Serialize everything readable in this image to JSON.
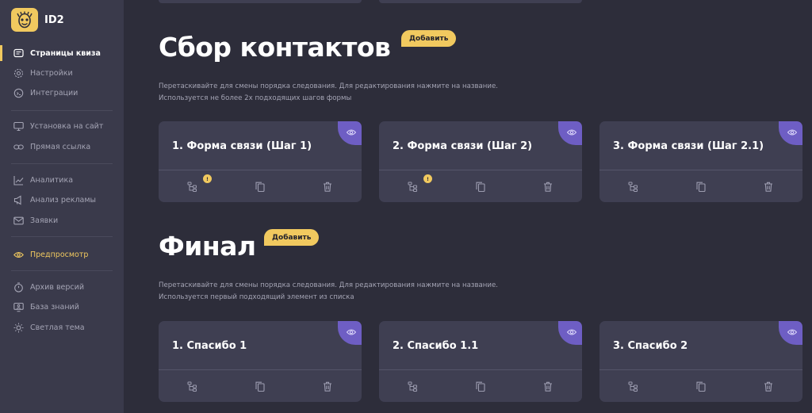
{
  "app": {
    "name": "ID2"
  },
  "sidebar": {
    "items": [
      {
        "label": "Страницы квиза",
        "icon": "pages-icon",
        "state": "active"
      },
      {
        "label": "Настройки",
        "icon": "gear-icon",
        "state": "normal"
      },
      {
        "label": "Интеграции",
        "icon": "puzzle-icon",
        "state": "normal"
      },
      {
        "label": "Установка на сайт",
        "icon": "monitor-icon",
        "state": "normal"
      },
      {
        "label": "Прямая ссылка",
        "icon": "link-icon",
        "state": "normal"
      },
      {
        "label": "Аналитика",
        "icon": "chart-line-icon",
        "state": "normal"
      },
      {
        "label": "Анализ рекламы",
        "icon": "megaphone-icon",
        "state": "normal"
      },
      {
        "label": "Заявки",
        "icon": "mail-icon",
        "state": "normal"
      },
      {
        "label": "Предпросмотр",
        "icon": "eye-icon",
        "state": "highlight"
      },
      {
        "label": "Архив версий",
        "icon": "stopwatch-icon",
        "state": "normal"
      },
      {
        "label": "База знаний",
        "icon": "screen-person-icon",
        "state": "normal"
      },
      {
        "label": "Светлая тема",
        "icon": "sun-icon",
        "state": "normal"
      }
    ]
  },
  "sections": {
    "contacts": {
      "title": "Сбор контактов",
      "add_label": "Добавить",
      "hint_1": "Перетаскивайте для смены порядка следования. Для редактирования нажмите на название.",
      "hint_2": "Используется не более 2х подходящих шагов формы",
      "cards": [
        {
          "title": "1. Форма связи (Шаг 1)",
          "badge": "!"
        },
        {
          "title": "2. Форма связи (Шаг 2)",
          "badge": "!"
        },
        {
          "title": "3. Форма связи (Шаг 2.1)",
          "badge": ""
        }
      ]
    },
    "final": {
      "title": "Финал",
      "add_label": "Добавить",
      "hint_1": "Перетаскивайте для смены порядка следования. Для редактирования нажмите на название.",
      "hint_2": "Используется первый подходящий элемент из списка",
      "cards": [
        {
          "title": "1. Спасибо 1",
          "badge": ""
        },
        {
          "title": "2. Спасибо 1.1",
          "badge": ""
        },
        {
          "title": "3. Спасибо 2",
          "badge": ""
        }
      ]
    }
  },
  "colors": {
    "accent": "#f1c95f",
    "eye_corner": "#6e5ec4",
    "background": "#2d2d3a",
    "sidebar": "#3a3a4b",
    "card": "#3f3f52"
  }
}
